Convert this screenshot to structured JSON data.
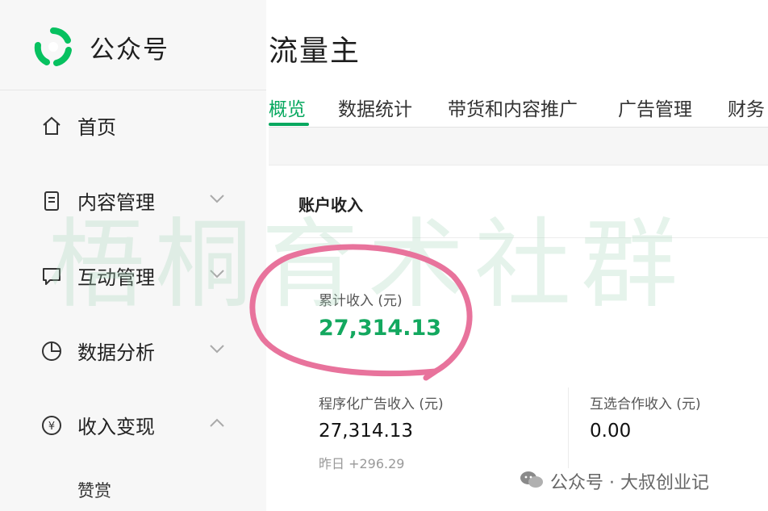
{
  "brand": {
    "name": "公众号",
    "logo_icon": "wechat-official-logo",
    "logo_color": "#07c160"
  },
  "sidebar": {
    "items": [
      {
        "label": "首页",
        "icon": "home-icon"
      },
      {
        "label": "内容管理",
        "icon": "document-icon",
        "chevron": "chevron-down-icon"
      },
      {
        "label": "互动管理",
        "icon": "chat-icon",
        "chevron": "chevron-down-icon"
      },
      {
        "label": "数据分析",
        "icon": "pie-chart-icon",
        "chevron": "chevron-down-icon"
      },
      {
        "label": "收入变现",
        "icon": "yuan-icon",
        "chevron": "chevron-up-icon",
        "expanded": true
      }
    ],
    "sub_items": [
      {
        "label": "赞赏"
      }
    ]
  },
  "main": {
    "title": "流量主",
    "tabs": [
      {
        "label": "概览",
        "active": true
      },
      {
        "label": "数据统计"
      },
      {
        "label": "带货和内容推广"
      },
      {
        "label": "广告管理"
      },
      {
        "label": "财务"
      }
    ],
    "account_card": {
      "title": "账户收入",
      "total": {
        "label": "累计收入 (元)",
        "value": "27,314.13"
      },
      "programmatic": {
        "label": "程序化广告收入 (元)",
        "value": "27,314.13",
        "yesterday": "昨日 +296.29"
      },
      "mutual": {
        "label": "互选合作收入 (元)",
        "value": "0.00"
      }
    }
  },
  "overlay": {
    "watermark": "梧桐育术社群",
    "footer": "公众号 · 大叔创业记",
    "ring_color": "#e8739c"
  },
  "colors": {
    "accent": "#07a85f",
    "value_green": "#13a85f"
  }
}
